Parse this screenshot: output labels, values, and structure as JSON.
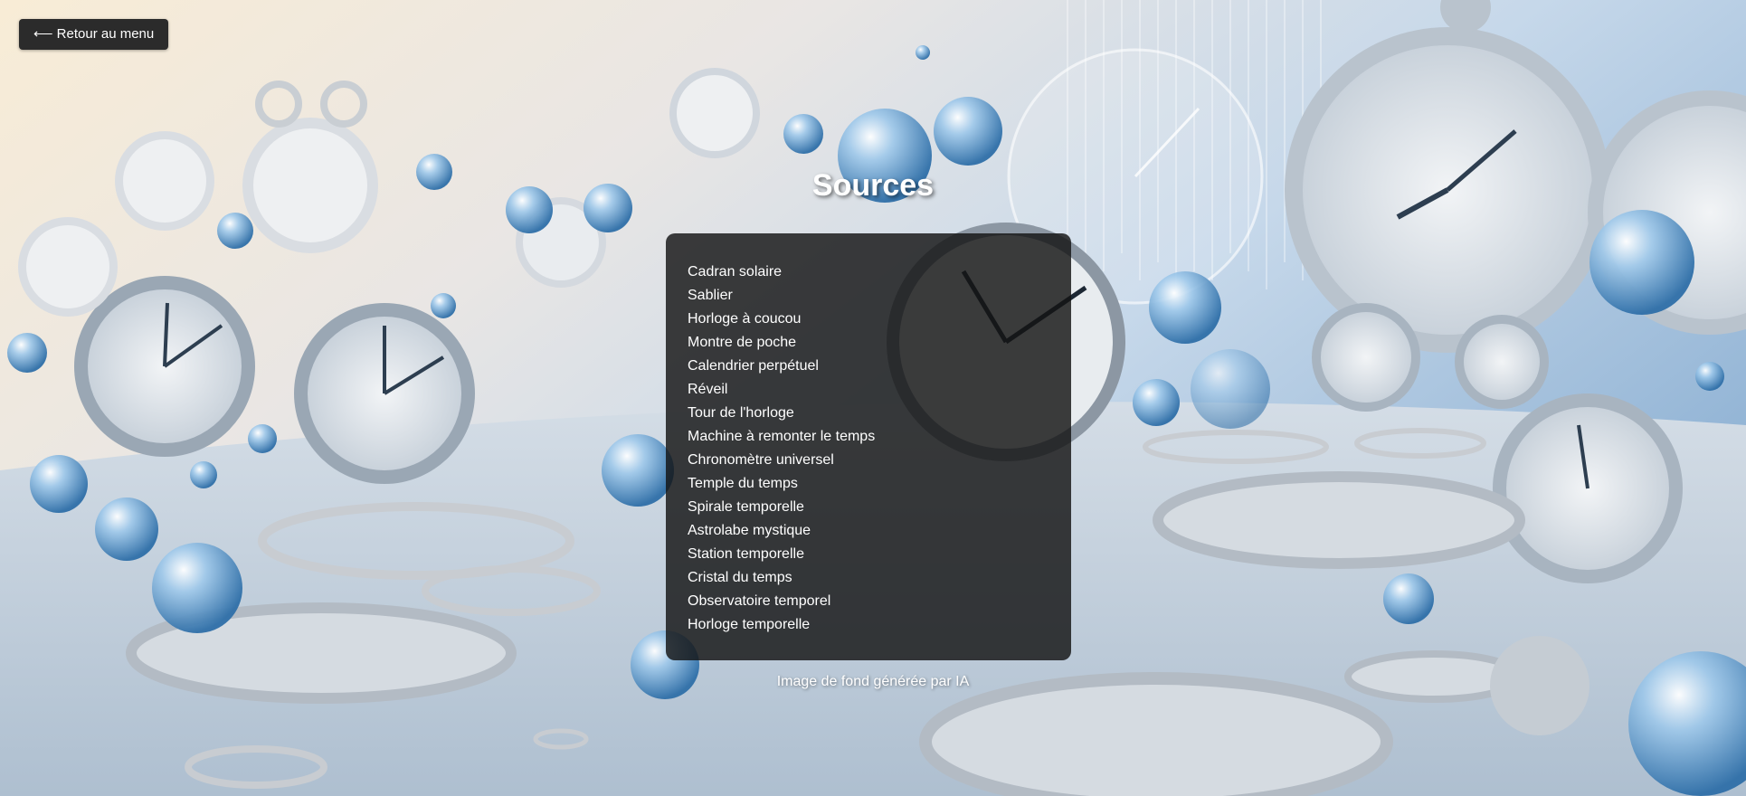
{
  "header": {
    "back_label": "⟵ Retour au menu"
  },
  "page": {
    "title": "Sources"
  },
  "sources": {
    "items": [
      "Cadran solaire",
      "Sablier",
      "Horloge à coucou",
      "Montre de poche",
      "Calendrier perpétuel",
      "Réveil",
      "Tour de l'horloge",
      "Machine à remonter le temps",
      "Chronomètre universel",
      "Temple du temps",
      "Spirale temporelle",
      "Astrolabe mystique",
      "Station temporelle",
      "Cristal du temps",
      "Observatoire temporel",
      "Horloge temporelle"
    ]
  },
  "footer": {
    "credit": "Image de fond générée par IA"
  },
  "colors": {
    "panel_bg": "rgba(20,20,20,0.82)",
    "button_bg": "#2b2b2b",
    "text": "#ffffff",
    "bg_light": "#f3ead9",
    "bg_blue": "#a9c6e0",
    "floor": "#c4d1dd"
  },
  "background": {
    "description_icon": "clock-background-image"
  }
}
